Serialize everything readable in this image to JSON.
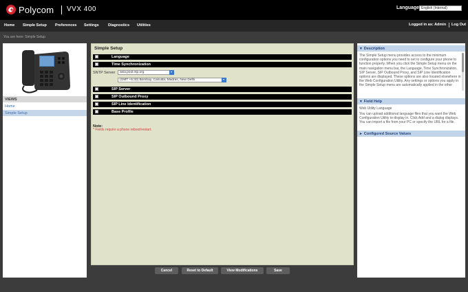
{
  "header": {
    "brand": "Polycom",
    "model": "VVX 400",
    "language_label": "Language",
    "language_value": "English (Internal)"
  },
  "nav": {
    "items": [
      "Home",
      "Simple Setup",
      "Preferences",
      "Settings",
      "Diagnostics",
      "Utilities"
    ],
    "logged_in": "Logged in as: Admin",
    "logout": "Log Out"
  },
  "breadcrumb": "You are here: Simple Setup",
  "views": {
    "heading": "VIEWS",
    "items": [
      "Home",
      "Simple Setup"
    ]
  },
  "main": {
    "title": "Simple Setup",
    "sections": [
      "Language",
      "Time Synchronization",
      "SIP Server",
      "SIP Outbound Proxy",
      "SIP Line Identification",
      "Base Profile"
    ],
    "sntp_label": "SNTP Server",
    "sntp_value": "asia.pool.ntp.org",
    "timezone_value": "(GMT +5:30) Bombay, Calcutta, Madras, New Delhi",
    "note_title": "Note:",
    "note_text": "* Fields require a phone reboot/restart."
  },
  "buttons": {
    "cancel": "Cancel",
    "reset": "Reset to Default",
    "view_mods": "View Modifications",
    "save": "Save"
  },
  "help": {
    "description_heading": "Description",
    "description_text": "The Simple Setup menu provides access to the minimum configuration options you need to set to configure your phone to function properly. When you click the Simple Setup menu on the main navigation menu bar, the Language, Time Synchronization, SIP Server, SIP Outbound Proxy, and SIP Line Identification options are displayed. These options are also located elsewhere in the Web Configuration Utility. Any settings or options you apply in the Simple Setup menu are automatically applied in the other",
    "field_help_heading": "Field Help",
    "field_help_title": "Web Utility Language",
    "field_help_text": "You can upload additional language files that you want the Web Configuration Utility to display in. Click Add and a dialog displays. You can import a file from your PC or specify the URL for a file.",
    "configured_heading": "Configured Source Values"
  },
  "colors": {
    "header_bg": "#000000",
    "nav_bg": "#262626",
    "panel_bg": "#e0e2ca",
    "accent_blue": "#3a78c8",
    "note_red": "#d04040"
  }
}
